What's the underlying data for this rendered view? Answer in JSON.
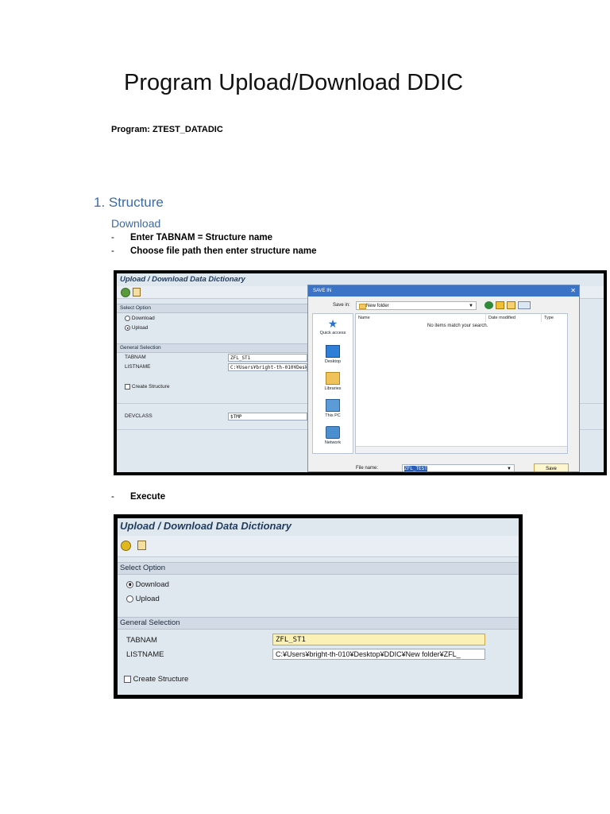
{
  "page": {
    "title": "Program Upload/Download DDIC",
    "program_line": "Program: ZTEST_DATADIC",
    "section_heading": "1. Structure",
    "sub_heading": "Download",
    "bullets": [
      "Enter TABNAM = Structure name",
      "Choose file path then enter structure name"
    ],
    "execute_bullet": "Execute",
    "dash": "-"
  },
  "screen1": {
    "title": "Upload / Download Data Dictionary",
    "select_option": "Select Option",
    "download": "Download",
    "upload": "Upload",
    "general_selection": "General Selection",
    "tabnam_label": "TABNAM",
    "tabnam_value": "ZFL_ST1",
    "listname_label": "LISTNAME",
    "listname_value": "C:¥Users¥bright-th-010¥Deskt",
    "create_structure": "Create Structure",
    "devclass_label": "DEVCLASS",
    "devclass_value": "$TMP",
    "selected_option": "Upload"
  },
  "dialog": {
    "title": "SAVE IN",
    "close": "✕",
    "save_in_label": "Save in:",
    "save_in_value": "New folder",
    "places": [
      "Quick access",
      "Desktop",
      "Libraries",
      "This PC",
      "Network"
    ],
    "columns": [
      "Name",
      "Date modified",
      "Type"
    ],
    "empty_message": "No items match your search.",
    "file_name_label": "File name:",
    "file_name_value": "ZFL_TEST",
    "save_button": "Save"
  },
  "screen2": {
    "title": "Upload / Download Data Dictionary",
    "select_option": "Select Option",
    "download": "Download",
    "upload": "Upload",
    "general_selection": "General Selection",
    "tabnam_label": "TABNAM",
    "tabnam_value": "ZFL_ST1",
    "listname_label": "LISTNAME",
    "listname_value": "C:¥Users¥bright-th-010¥Desktop¥DDIC¥New folder¥ZFL_",
    "create_structure": "Create Structure",
    "selected_option": "Download"
  },
  "colors": {
    "heading_blue": "#3a6aa8",
    "sap_background": "#dfe7ef",
    "highlight_field": "#fbf0b6"
  }
}
